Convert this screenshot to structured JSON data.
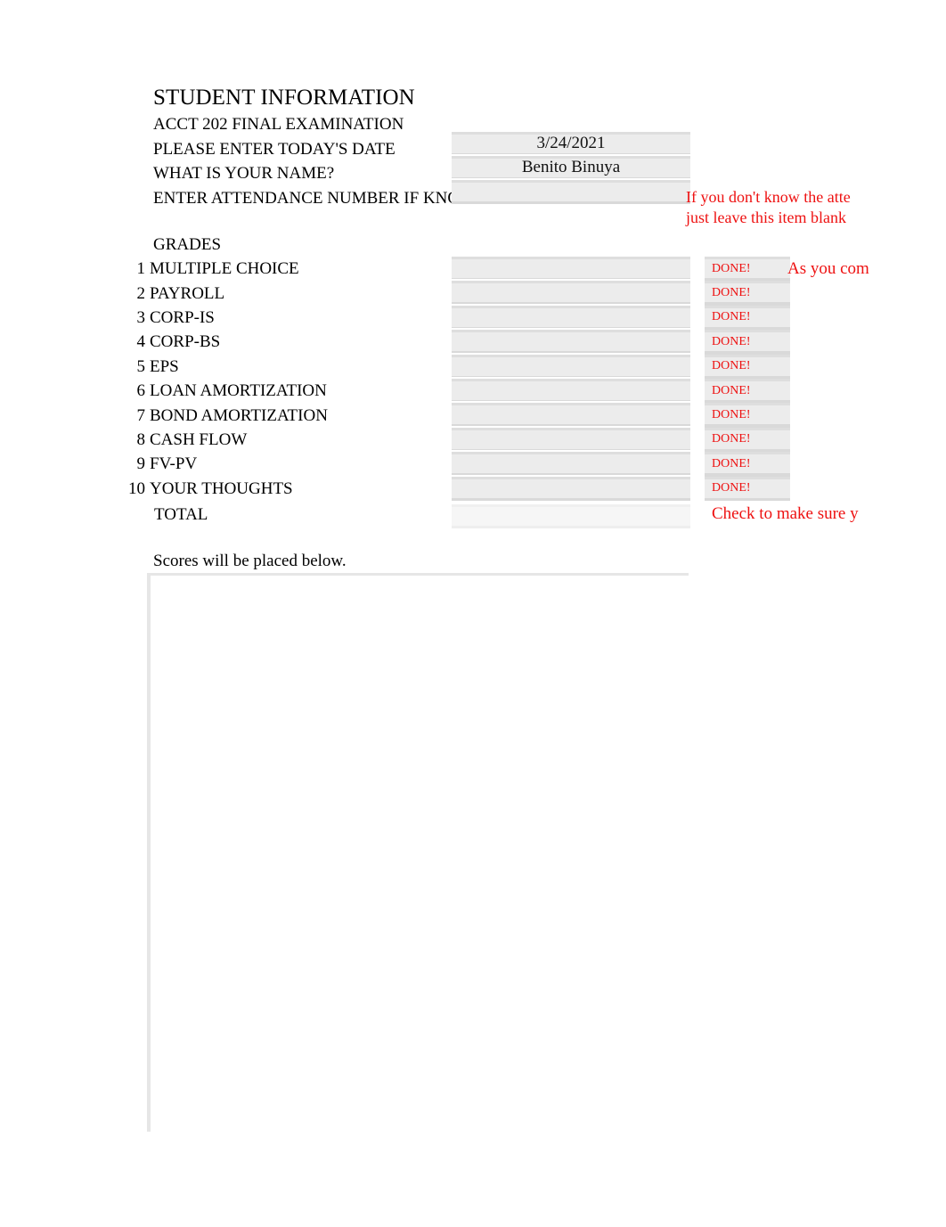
{
  "header": {
    "title": "STUDENT INFORMATION",
    "subtitle": "ACCT 202 FINAL EXAMINATION",
    "fields": [
      {
        "label": "PLEASE ENTER TODAY'S DATE",
        "value": "3/24/2021"
      },
      {
        "label": "WHAT IS YOUR NAME?",
        "value": "Benito Binuya"
      },
      {
        "label": "ENTER ATTENDANCE NUMBER IF KNOWN",
        "value": ""
      }
    ]
  },
  "notes": {
    "attendance_line1": "If you don't know the atte",
    "attendance_line2": "just leave this item blank",
    "completion": "As you com",
    "check": "Check to make sure y"
  },
  "grades": {
    "heading": "GRADES",
    "total_label": "TOTAL",
    "total_value": "",
    "rows": [
      {
        "num": "1",
        "name": "MULTIPLE CHOICE",
        "score": "",
        "status": "DONE!"
      },
      {
        "num": "2",
        "name": "PAYROLL",
        "score": "",
        "status": "DONE!"
      },
      {
        "num": "3",
        "name": "CORP-IS",
        "score": "",
        "status": "DONE!"
      },
      {
        "num": "4",
        "name": "CORP-BS",
        "score": "",
        "status": "DONE!"
      },
      {
        "num": "5",
        "name": "EPS",
        "score": "",
        "status": "DONE!"
      },
      {
        "num": "6",
        "name": "LOAN AMORTIZATION",
        "score": "",
        "status": "DONE!"
      },
      {
        "num": "7",
        "name": "BOND AMORTIZATION",
        "score": "",
        "status": "DONE!"
      },
      {
        "num": "8",
        "name": "CASH FLOW",
        "score": "",
        "status": "DONE!"
      },
      {
        "num": "9",
        "name": "FV-PV",
        "score": "",
        "status": "DONE!"
      },
      {
        "num": "10",
        "name": "YOUR THOUGHTS",
        "score": "",
        "status": "DONE!"
      }
    ]
  },
  "footer": {
    "scores_note": "Scores will be placed below."
  },
  "colors": {
    "note_red": "#ee1111",
    "cell_fill": "#ececec",
    "cell_edge": "#d9d9d9",
    "box_border": "#e6e6e6"
  }
}
